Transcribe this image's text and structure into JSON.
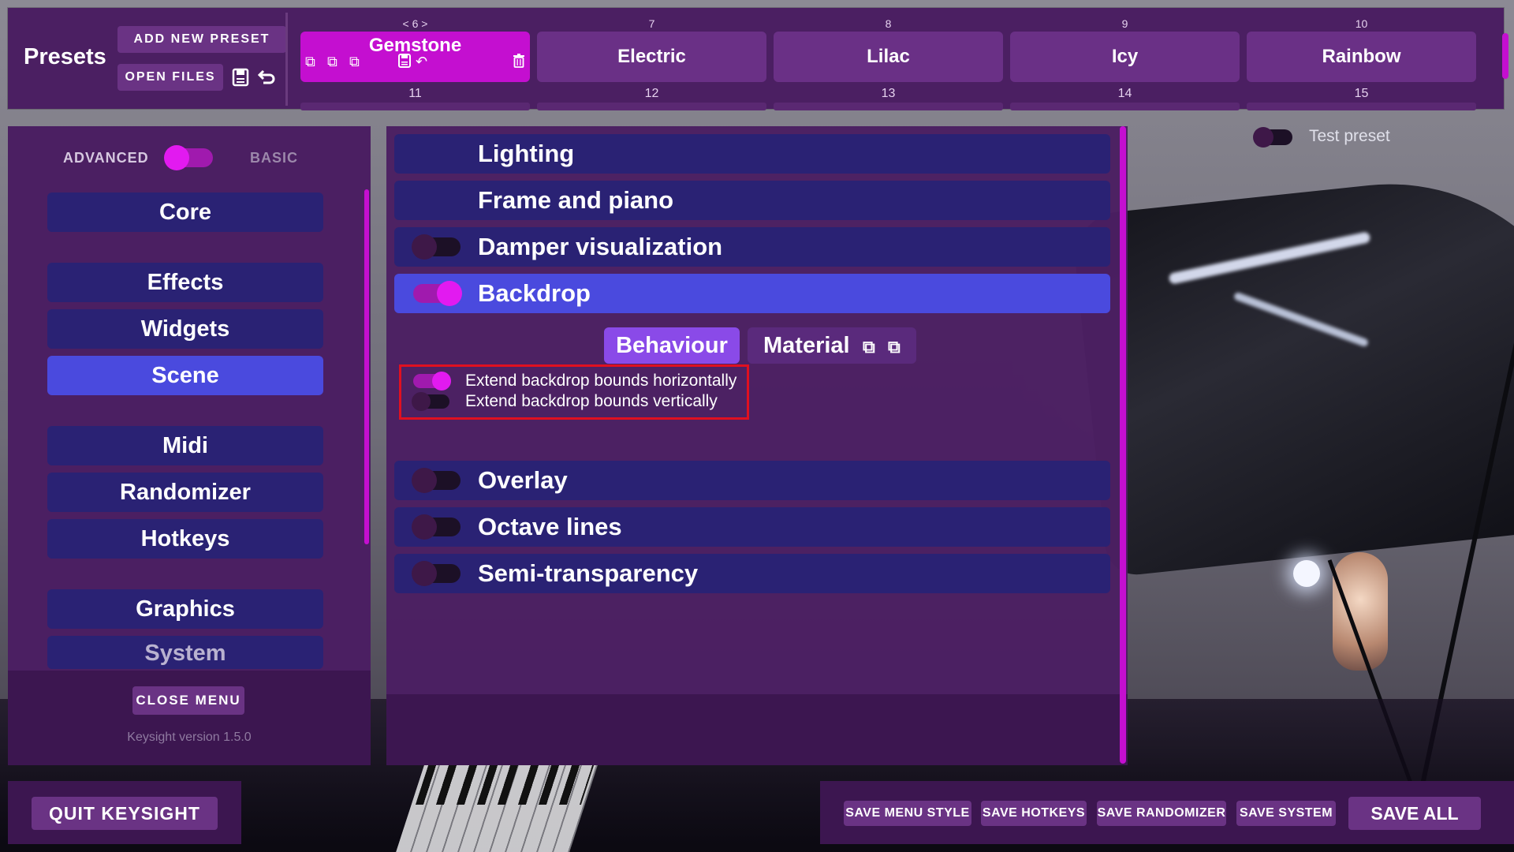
{
  "header": {
    "title": "Presets",
    "add_new_preset": "ADD NEW PRESET",
    "open_files": "OPEN FILES",
    "nav_indicator": "< 6 >"
  },
  "presets": [
    {
      "name": "Gemstone",
      "top_num": "",
      "bottom_num": "11",
      "active": true
    },
    {
      "name": "Electric",
      "top_num": "7",
      "bottom_num": "12",
      "active": false
    },
    {
      "name": "Lilac",
      "top_num": "8",
      "bottom_num": "13",
      "active": false
    },
    {
      "name": "Icy",
      "top_num": "9",
      "bottom_num": "14",
      "active": false
    },
    {
      "name": "Rainbow",
      "top_num": "10",
      "bottom_num": "15",
      "active": false
    }
  ],
  "mode": {
    "advanced": "ADVANCED",
    "basic": "BASIC",
    "selected": "ADVANCED"
  },
  "nav": {
    "items": [
      "Core",
      "Effects",
      "Widgets",
      "Scene",
      "Midi",
      "Randomizer",
      "Hotkeys",
      "Graphics",
      "System"
    ],
    "active": "Scene"
  },
  "left_footer": {
    "close_menu": "CLOSE MENU",
    "version": "Keysight version 1.5.0"
  },
  "sections": [
    {
      "title": "Lighting",
      "has_toggle": false
    },
    {
      "title": "Frame and piano",
      "has_toggle": false
    },
    {
      "title": "Damper visualization",
      "has_toggle": true,
      "enabled": false
    },
    {
      "title": "Backdrop",
      "has_toggle": true,
      "enabled": true,
      "expanded": true
    },
    {
      "title": "Overlay",
      "has_toggle": true,
      "enabled": false
    },
    {
      "title": "Octave lines",
      "has_toggle": true,
      "enabled": false
    },
    {
      "title": "Semi-transparency",
      "has_toggle": true,
      "enabled": false
    }
  ],
  "subtabs": {
    "behaviour": "Behaviour",
    "material": "Material",
    "active": "Behaviour"
  },
  "options": [
    {
      "label": "Extend backdrop bounds horizontally",
      "enabled": true
    },
    {
      "label": "Extend backdrop bounds vertically",
      "enabled": false
    }
  ],
  "test_preset": {
    "label": "Test preset",
    "enabled": false
  },
  "bottom": {
    "quit": "QUIT KEYSIGHT",
    "save_menu_style": "SAVE MENU STYLE",
    "save_hotkeys": "SAVE HOTKEYS",
    "save_randomizer": "SAVE RANDOMIZER",
    "save_system": "SAVE SYSTEM",
    "save_all": "SAVE ALL"
  },
  "colors": {
    "panel": "#4b1f62",
    "item": "#2a2274",
    "active_item": "#4a4ade",
    "accent": "#c40fd0",
    "highlight": "#e01020"
  }
}
